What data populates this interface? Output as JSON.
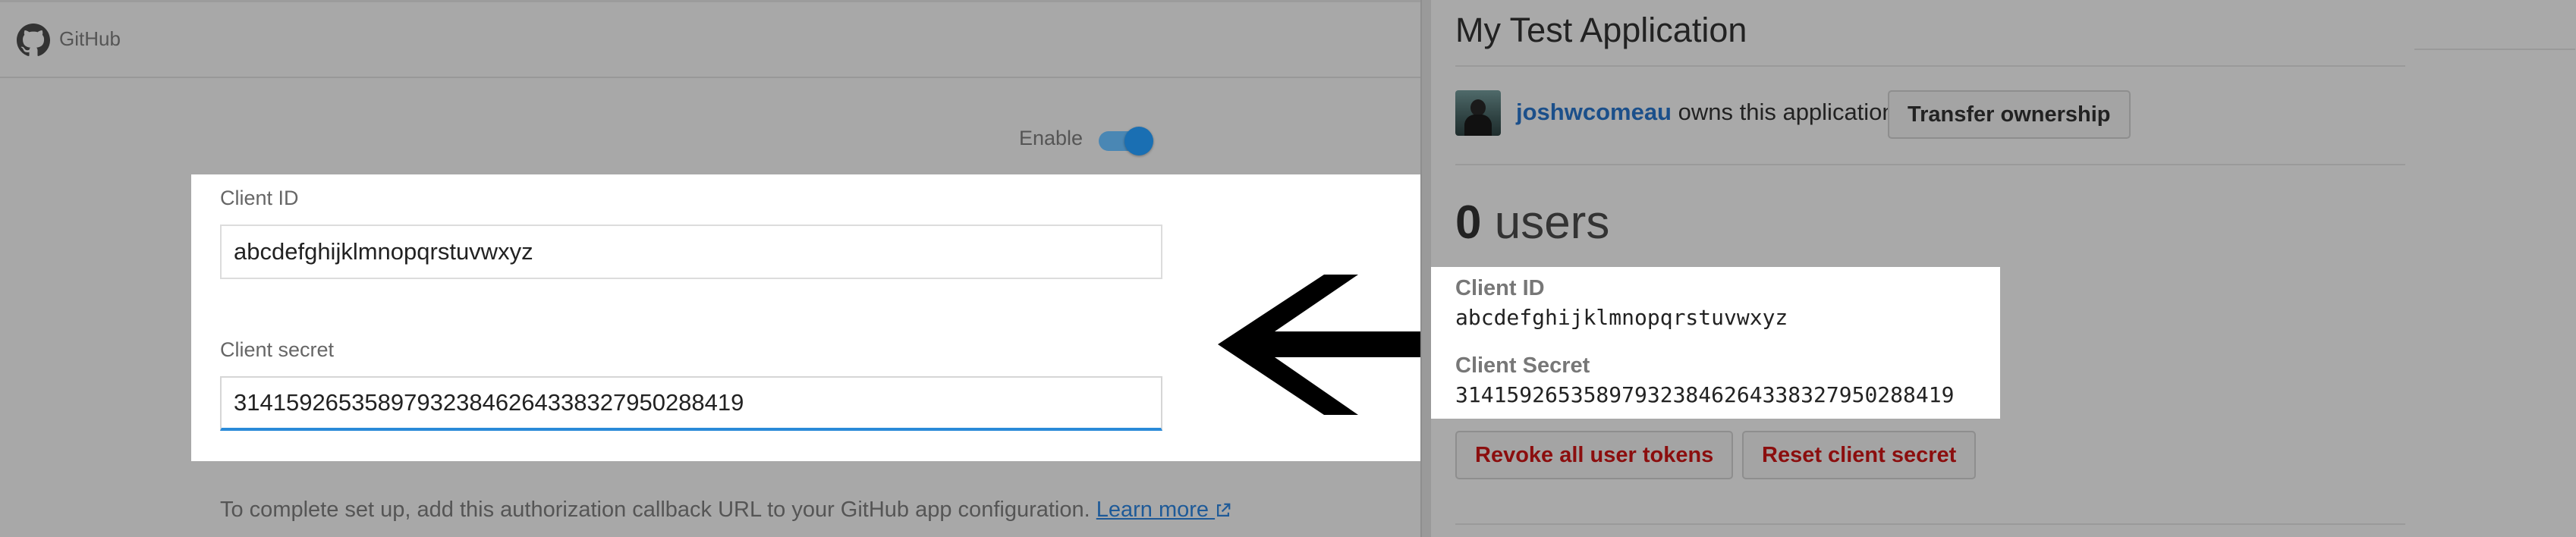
{
  "left": {
    "brand": "GitHub",
    "enable_label": "Enable",
    "enable_toggle_on": true,
    "client_id_label": "Client ID",
    "client_id_value": "abcdefghijklmnopqrstuvwxyz",
    "client_secret_label": "Client secret",
    "client_secret_value": "31415926535897932384626433832795028841­9",
    "callback_text": "To complete set up, add this authorization callback URL to your GitHub app configuration.",
    "learn_more_link": "Learn more"
  },
  "right": {
    "app_title": "My Test Application",
    "owner_name": "joshwcomeau",
    "owner_suffix": " owns this application.",
    "transfer_button": "Transfer ownership",
    "users_count": "0",
    "users_unit": " users",
    "client_id_label": "Client ID",
    "client_id_value": "abcdefghijklmnopqrstuvwxyz",
    "client_secret_label": "Client Secret",
    "client_secret_value": "314159265358979323846264338327950288419",
    "revoke_button": "Revoke all user tokens",
    "reset_button": "Reset client secret"
  },
  "colors": {
    "dim_background": "#a9a9a9",
    "link_blue": "#1b4f8a",
    "danger_red": "#8b0e0e",
    "focus_blue": "#2a8ad8",
    "toggle_blue": "#1a6fb3"
  },
  "icons": {
    "brand_icon": "github-octocat-icon",
    "arrow_icon": "left-arrow-icon",
    "external_link_icon": "external-link-icon"
  }
}
